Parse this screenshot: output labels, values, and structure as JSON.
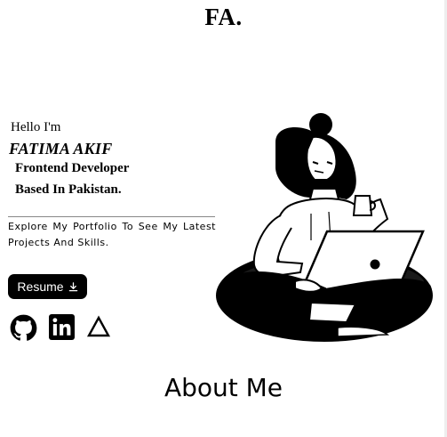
{
  "header": {
    "logo": "FA."
  },
  "hero": {
    "greeting": "Hello I'm",
    "name": "FATIMA AKIF",
    "role": "Frontend Developer",
    "location": "Based In Pakistan.",
    "tagline": "Explore My Portfolio To See My Latest Projects And Skills.",
    "resume_label": "Resume",
    "resume_icon": "download-icon"
  },
  "social": [
    {
      "name": "github-icon"
    },
    {
      "name": "linkedin-icon"
    },
    {
      "name": "vercel-icon"
    }
  ],
  "illustration": {
    "name": "woman-with-laptop-illustration"
  },
  "about": {
    "title": "About Me"
  }
}
